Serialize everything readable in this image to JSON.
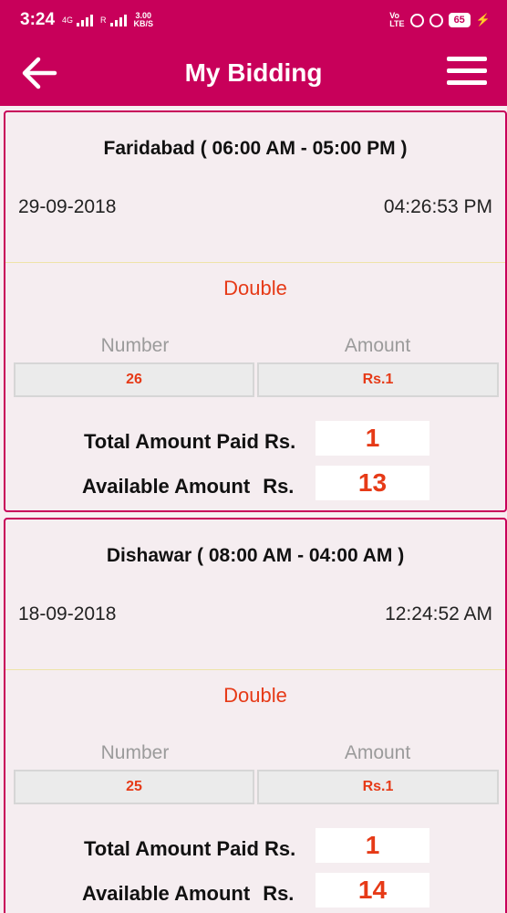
{
  "status_bar": {
    "time": "3:24",
    "network_type": "4G",
    "roaming": "R",
    "speed_value": "3.00",
    "speed_unit": "KB/S",
    "volte": "Vo",
    "lte": "LTE",
    "battery": "65"
  },
  "app_bar": {
    "title": "My Bidding",
    "back_icon": "arrow-left-icon",
    "menu_icon": "hamburger-menu-icon"
  },
  "colors": {
    "primary": "#c8005a",
    "accent_text": "#e63a17"
  },
  "bids": [
    {
      "market": "Faridabad ( 06:00 AM - 05:00 PM )",
      "date": "29-09-2018",
      "time": "04:26:53 PM",
      "game_type": "Double",
      "number_header": "Number",
      "amount_header": "Amount",
      "number": "26",
      "amount": "Rs.1",
      "total_label": "Total Amount Paid Rs.",
      "total_value": "1",
      "available_label": "Available Amount",
      "available_rs": "Rs.",
      "available_value": "13"
    },
    {
      "market": "Dishawar ( 08:00 AM - 04:00 AM )",
      "date": "18-09-2018",
      "time": "12:24:52 AM",
      "game_type": "Double",
      "number_header": "Number",
      "amount_header": "Amount",
      "number": "25",
      "amount": "Rs.1",
      "total_label": "Total Amount Paid Rs.",
      "total_value": "1",
      "available_label": "Available Amount",
      "available_rs": "Rs.",
      "available_value": "14"
    }
  ]
}
